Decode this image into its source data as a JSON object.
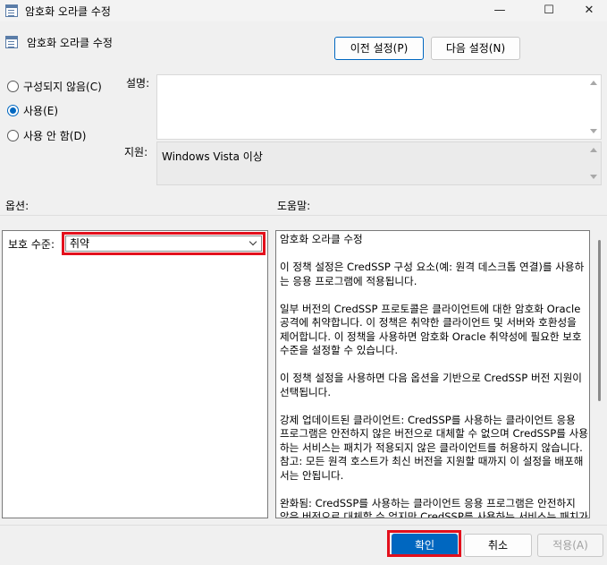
{
  "window": {
    "title": "암호화 오라클 수정",
    "minimize_icon": "—",
    "maximize_icon": "☐",
    "close_icon": "✕"
  },
  "header": {
    "policy_title": "암호화 오라클 수정",
    "prev_button": "이전 설정(P)",
    "next_button": "다음 설정(N)"
  },
  "state": {
    "options": [
      {
        "label": "구성되지 않음(C)",
        "checked": false
      },
      {
        "label": "사용(E)",
        "checked": true
      },
      {
        "label": "사용 안 함(D)",
        "checked": false
      }
    ]
  },
  "comment": {
    "label": "설명:",
    "value": ""
  },
  "supported": {
    "label": "지원:",
    "value": "Windows Vista 이상"
  },
  "options_section": {
    "label": "옵션:",
    "protection_label": "보호 수준:",
    "protection_value": "취약"
  },
  "help_section": {
    "label": "도움말:",
    "paragraphs": [
      "암호화 오라클 수정",
      "이 정책 설정은 CredSSP 구성 요소(예: 원격 데스크톱 연결)를 사용하는 응용 프로그램에 적용됩니다.",
      "일부 버전의 CredSSP 프로토콜은 클라이언트에 대한 암호화 Oracle 공격에 취약합니다.  이 정책은 취약한 클라이언트 및 서버와 호환성을 제어합니다.  이 정책을 사용하면 암호화 Oracle 취약성에 필요한 보호 수준을 설정할 수 있습니다.",
      "이 정책 설정을 사용하면 다음 옵션을 기반으로 CredSSP 버전 지원이 선택됩니다.",
      "강제 업데이트된 클라이언트: CredSSP를 사용하는 클라이언트 응용 프로그램은 안전하지 않은 버전으로 대체할 수 없으며 CredSSP를 사용하는 서비스는 패치가 적용되지 않은 클라이언트를 허용하지 않습니다. 참고: 모든 원격 호스트가 최신 버전을 지원할 때까지 이 설정을 배포해서는 안됩니다.",
      "완화됨: CredSSP를 사용하는 클라이언트 응용 프로그램은 안전하지 않은 버전으로 대체할 수 없지만 CredSSP를 사용하는 서비스는 패치가 적용되지 않은 클라이언트를 허용합니다. 패치가 적용되지 않은"
    ]
  },
  "footer": {
    "ok_button": "확인",
    "cancel_button": "취소",
    "apply_button": "적용(A)"
  },
  "colors": {
    "highlight_red": "#e3101c",
    "accent_blue": "#0067c0"
  }
}
